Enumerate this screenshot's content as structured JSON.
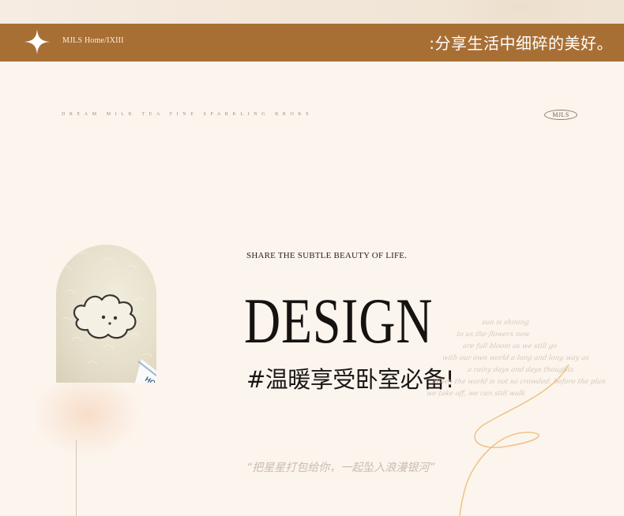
{
  "header": {
    "brand": "MJLS Home/IXIII",
    "tagline": ":分享生活中细碎的美好。"
  },
  "decor_line": "DREAM MILK TEA FINE SPARKLING BROKE",
  "badge": "MJLS",
  "hero": {
    "share_line": "SHARE THE SUBTLE BEAUTY OF LIFE.",
    "title": "DESIGN",
    "subtitle": "#温暖享受卧室必备!",
    "image_corner_text": "HO"
  },
  "script_text": [
    "sun is shining",
    "to us the flowers now",
    "are full bloom as we still go",
    "with our own world a long and long way as",
    "a rainy days and days thoughts",
    "When the world is not so crowded, before the plan",
    "we take off, we can still walk"
  ],
  "quote": "“把星星打包给你，一起坠入浪漫银河”",
  "colors": {
    "header_bg": "#a86f35",
    "page_bg": "#fcf5ee",
    "accent_line": "#f0c48a"
  },
  "icons": {
    "sparkle": "four-point-star-icon"
  }
}
